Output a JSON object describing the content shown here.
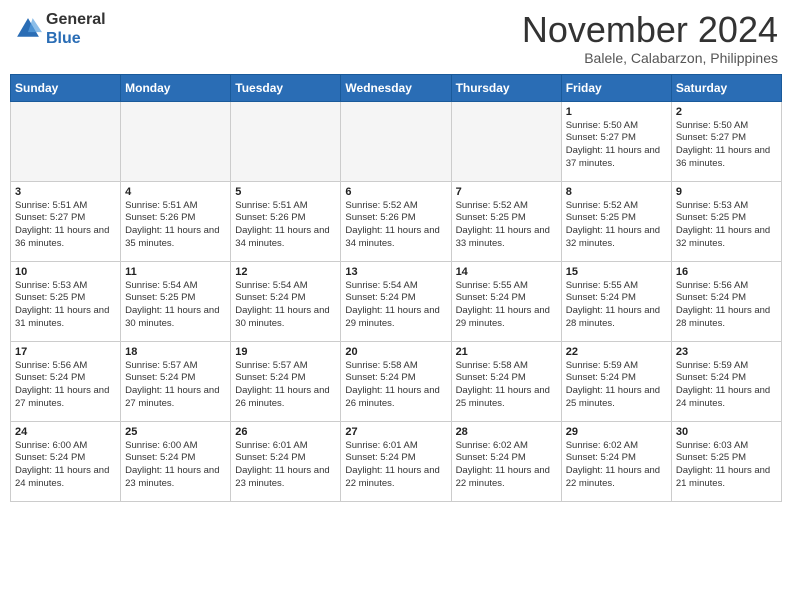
{
  "header": {
    "logo": {
      "general": "General",
      "blue": "Blue"
    },
    "title": "November 2024",
    "location": "Balele, Calabarzon, Philippines"
  },
  "days_of_week": [
    "Sunday",
    "Monday",
    "Tuesday",
    "Wednesday",
    "Thursday",
    "Friday",
    "Saturday"
  ],
  "weeks": [
    [
      {
        "day": "",
        "empty": true
      },
      {
        "day": "",
        "empty": true
      },
      {
        "day": "",
        "empty": true
      },
      {
        "day": "",
        "empty": true
      },
      {
        "day": "",
        "empty": true
      },
      {
        "day": "1",
        "sunrise": "5:50 AM",
        "sunset": "5:27 PM",
        "daylight": "11 hours and 37 minutes."
      },
      {
        "day": "2",
        "sunrise": "5:50 AM",
        "sunset": "5:27 PM",
        "daylight": "11 hours and 36 minutes."
      }
    ],
    [
      {
        "day": "3",
        "sunrise": "5:51 AM",
        "sunset": "5:27 PM",
        "daylight": "11 hours and 36 minutes."
      },
      {
        "day": "4",
        "sunrise": "5:51 AM",
        "sunset": "5:26 PM",
        "daylight": "11 hours and 35 minutes."
      },
      {
        "day": "5",
        "sunrise": "5:51 AM",
        "sunset": "5:26 PM",
        "daylight": "11 hours and 34 minutes."
      },
      {
        "day": "6",
        "sunrise": "5:52 AM",
        "sunset": "5:26 PM",
        "daylight": "11 hours and 34 minutes."
      },
      {
        "day": "7",
        "sunrise": "5:52 AM",
        "sunset": "5:25 PM",
        "daylight": "11 hours and 33 minutes."
      },
      {
        "day": "8",
        "sunrise": "5:52 AM",
        "sunset": "5:25 PM",
        "daylight": "11 hours and 32 minutes."
      },
      {
        "day": "9",
        "sunrise": "5:53 AM",
        "sunset": "5:25 PM",
        "daylight": "11 hours and 32 minutes."
      }
    ],
    [
      {
        "day": "10",
        "sunrise": "5:53 AM",
        "sunset": "5:25 PM",
        "daylight": "11 hours and 31 minutes."
      },
      {
        "day": "11",
        "sunrise": "5:54 AM",
        "sunset": "5:25 PM",
        "daylight": "11 hours and 30 minutes."
      },
      {
        "day": "12",
        "sunrise": "5:54 AM",
        "sunset": "5:24 PM",
        "daylight": "11 hours and 30 minutes."
      },
      {
        "day": "13",
        "sunrise": "5:54 AM",
        "sunset": "5:24 PM",
        "daylight": "11 hours and 29 minutes."
      },
      {
        "day": "14",
        "sunrise": "5:55 AM",
        "sunset": "5:24 PM",
        "daylight": "11 hours and 29 minutes."
      },
      {
        "day": "15",
        "sunrise": "5:55 AM",
        "sunset": "5:24 PM",
        "daylight": "11 hours and 28 minutes."
      },
      {
        "day": "16",
        "sunrise": "5:56 AM",
        "sunset": "5:24 PM",
        "daylight": "11 hours and 28 minutes."
      }
    ],
    [
      {
        "day": "17",
        "sunrise": "5:56 AM",
        "sunset": "5:24 PM",
        "daylight": "11 hours and 27 minutes."
      },
      {
        "day": "18",
        "sunrise": "5:57 AM",
        "sunset": "5:24 PM",
        "daylight": "11 hours and 27 minutes."
      },
      {
        "day": "19",
        "sunrise": "5:57 AM",
        "sunset": "5:24 PM",
        "daylight": "11 hours and 26 minutes."
      },
      {
        "day": "20",
        "sunrise": "5:58 AM",
        "sunset": "5:24 PM",
        "daylight": "11 hours and 26 minutes."
      },
      {
        "day": "21",
        "sunrise": "5:58 AM",
        "sunset": "5:24 PM",
        "daylight": "11 hours and 25 minutes."
      },
      {
        "day": "22",
        "sunrise": "5:59 AM",
        "sunset": "5:24 PM",
        "daylight": "11 hours and 25 minutes."
      },
      {
        "day": "23",
        "sunrise": "5:59 AM",
        "sunset": "5:24 PM",
        "daylight": "11 hours and 24 minutes."
      }
    ],
    [
      {
        "day": "24",
        "sunrise": "6:00 AM",
        "sunset": "5:24 PM",
        "daylight": "11 hours and 24 minutes."
      },
      {
        "day": "25",
        "sunrise": "6:00 AM",
        "sunset": "5:24 PM",
        "daylight": "11 hours and 23 minutes."
      },
      {
        "day": "26",
        "sunrise": "6:01 AM",
        "sunset": "5:24 PM",
        "daylight": "11 hours and 23 minutes."
      },
      {
        "day": "27",
        "sunrise": "6:01 AM",
        "sunset": "5:24 PM",
        "daylight": "11 hours and 22 minutes."
      },
      {
        "day": "28",
        "sunrise": "6:02 AM",
        "sunset": "5:24 PM",
        "daylight": "11 hours and 22 minutes."
      },
      {
        "day": "29",
        "sunrise": "6:02 AM",
        "sunset": "5:24 PM",
        "daylight": "11 hours and 22 minutes."
      },
      {
        "day": "30",
        "sunrise": "6:03 AM",
        "sunset": "5:25 PM",
        "daylight": "11 hours and 21 minutes."
      }
    ]
  ]
}
